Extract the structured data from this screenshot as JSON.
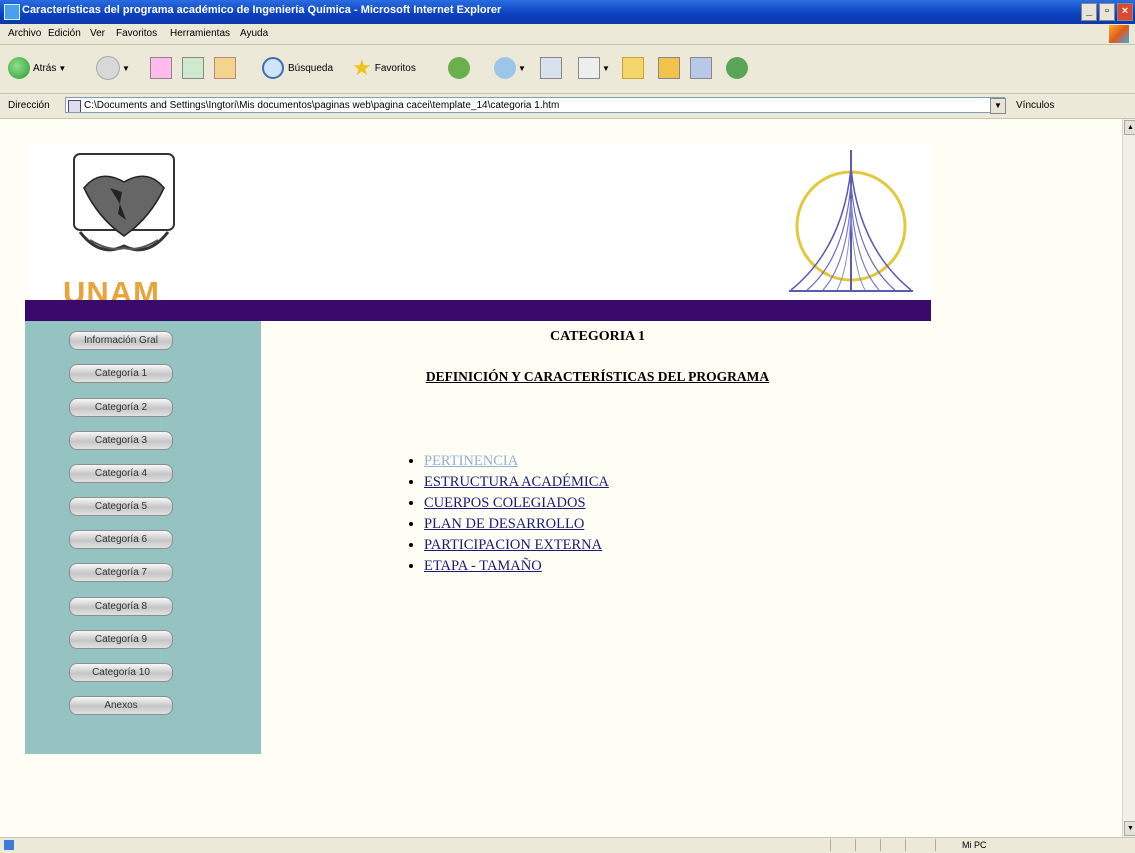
{
  "window": {
    "title": "Características del programa académico de Ingeniería Química - Microsoft Internet Explorer",
    "controls": [
      "_",
      "▫",
      "×"
    ]
  },
  "menu": [
    "Archivo",
    "Edición",
    "Ver",
    "Favoritos",
    "Herramientas",
    "Ayuda"
  ],
  "toolbar": {
    "back_label": "Atrás",
    "search_label": "Búsqueda",
    "favorites_label": "Favoritos"
  },
  "address": {
    "label": "Dirección",
    "url": "C:\\Documents and Settings\\Ingtori\\Mis documentos\\paginas web\\pagina cacei\\template_14\\categoria 1.htm",
    "links_label": "Vínculos"
  },
  "banner": {
    "unam_text": "UNAM",
    "colors": {
      "unam_gold": "#e8a33a",
      "header_bar": "#3a0a6a",
      "sidebar": "#94c3c1"
    }
  },
  "sidebar": {
    "items": [
      "Información Gral",
      "Categoría 1",
      "Categoría 2",
      "Categoría 3",
      "Categoría 4",
      "Categoría 5",
      "Categoría 6",
      "Categoría 7",
      "Categoría 8",
      "Categoría 9",
      "Categoría 10",
      "Anexos"
    ]
  },
  "content": {
    "category_title": "CATEGORIA 1",
    "section_title": "DEFINICIÓN Y CARACTERÍSTICAS DEL PROGRAMA",
    "links": [
      "PERTINENCIA",
      "ESTRUCTURA ACADÉMICA",
      "CUERPOS COLEGIADOS",
      "PLAN DE DESARROLLO",
      "PARTICIPACION EXTERNA",
      "ETAPA - TAMAÑO"
    ]
  },
  "status": {
    "zone": "Mi PC"
  }
}
